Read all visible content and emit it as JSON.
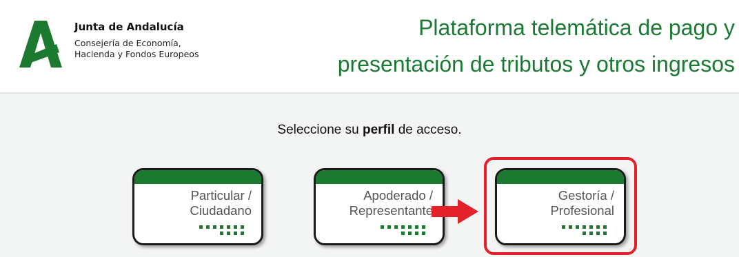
{
  "header": {
    "org_name": "Junta de Andalucía",
    "org_sub_line1": "Consejería de Economía,",
    "org_sub_line2": "Hacienda y Fondos Europeos",
    "title_line1": "Plataforma telemática de pago y",
    "title_line2": "presentación de tributos y otros ingresos"
  },
  "prompt": {
    "before": "Seleccione su ",
    "bold": "perfil",
    "after": " de acceso."
  },
  "profiles": [
    {
      "line1": "Particular /",
      "line2": "Ciudadano"
    },
    {
      "line1": "Apoderado /",
      "line2": "Representante"
    },
    {
      "line1": "Gestoría /",
      "line2": "Profesional"
    }
  ],
  "colors": {
    "brand_green": "#1b7a30",
    "title_green": "#1a7a33",
    "highlight_red": "#e4202a"
  },
  "annotation": {
    "selected_profile": "Gestoría / Profesional",
    "arrow_icon": "right-arrow-icon"
  }
}
